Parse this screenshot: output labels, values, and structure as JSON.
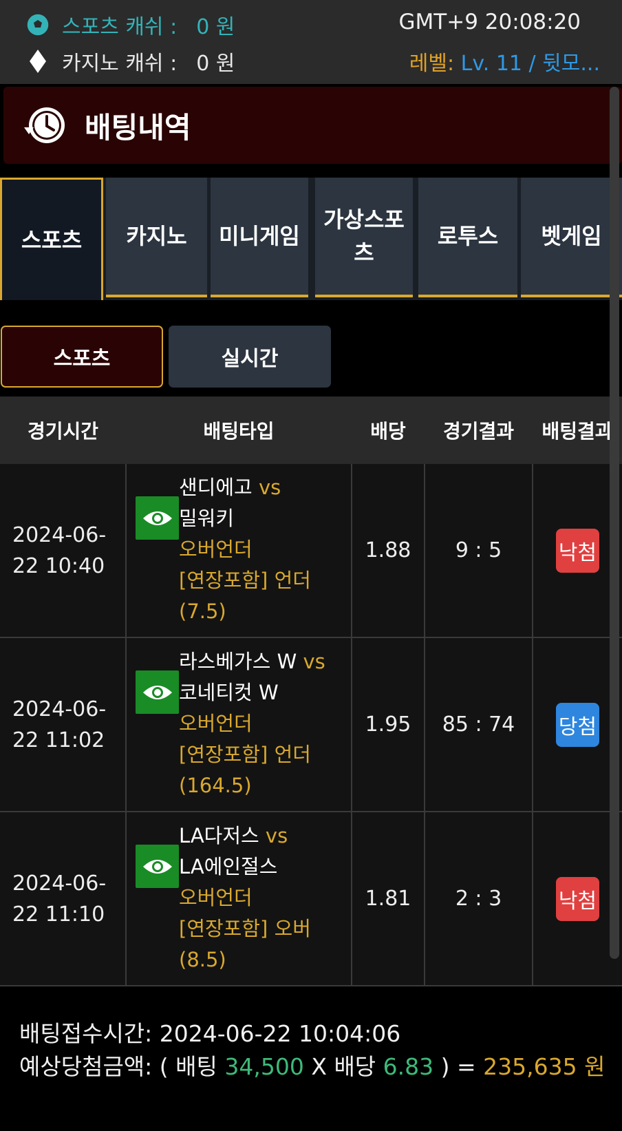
{
  "header": {
    "sports_cash_label": "스포츠 캐쉬 :",
    "sports_cash_value": "0 원",
    "casino_cash_label": "카지노 캐쉬 :",
    "casino_cash_value": "0 원",
    "clock": "GMT+9 20:08:20",
    "level_label": "레벨:",
    "level_value": "Lv. 11 / 뒷모..."
  },
  "page": {
    "title": "배팅내역"
  },
  "tabs": [
    "스포츠",
    "카지노",
    "미니게임",
    "가상스포츠",
    "로투스",
    "벳게임"
  ],
  "subtabs": [
    "스포츠",
    "실시간"
  ],
  "table": {
    "headers": [
      "경기시간",
      "배팅타입",
      "배당",
      "경기결과",
      "배팅결과"
    ],
    "rows": [
      {
        "time": "2024-06-\n22 10:40",
        "home": "샌디에고",
        "vs": "vs",
        "away": "밀워키",
        "market": "오버언더",
        "pick": "[연장포함] 언더",
        "line": "(7.5)",
        "odds": "1.88",
        "score": "9 : 5",
        "result": "낙첨",
        "result_type": "lose"
      },
      {
        "time": "2024-06-\n22 11:02",
        "home": "라스베가스 W",
        "vs": "vs",
        "away": "코네티컷 W",
        "market": "오버언더",
        "pick": "[연장포함] 언더",
        "line": "(164.5)",
        "odds": "1.95",
        "score": "85 : 74",
        "result": "당첨",
        "result_type": "win"
      },
      {
        "time": "2024-06-\n22 11:10",
        "home": "LA다저스",
        "vs": "vs",
        "away": "LA에인절스",
        "market": "오버언더",
        "pick": "[연장포함] 오버",
        "line": "(8.5)",
        "odds": "1.81",
        "score": "2 : 3",
        "result": "낙첨",
        "result_type": "lose"
      }
    ]
  },
  "summary": {
    "received_label": "배팅접수시간:",
    "received_value": "2024-06-22 10:04:06",
    "expected_label": "예상당첨금액:",
    "open": "( 배팅",
    "stake": "34,500",
    "times": "X 배당",
    "total_odds": "6.83",
    "close": ") =",
    "payout": "235,635",
    "unit": "원"
  }
}
